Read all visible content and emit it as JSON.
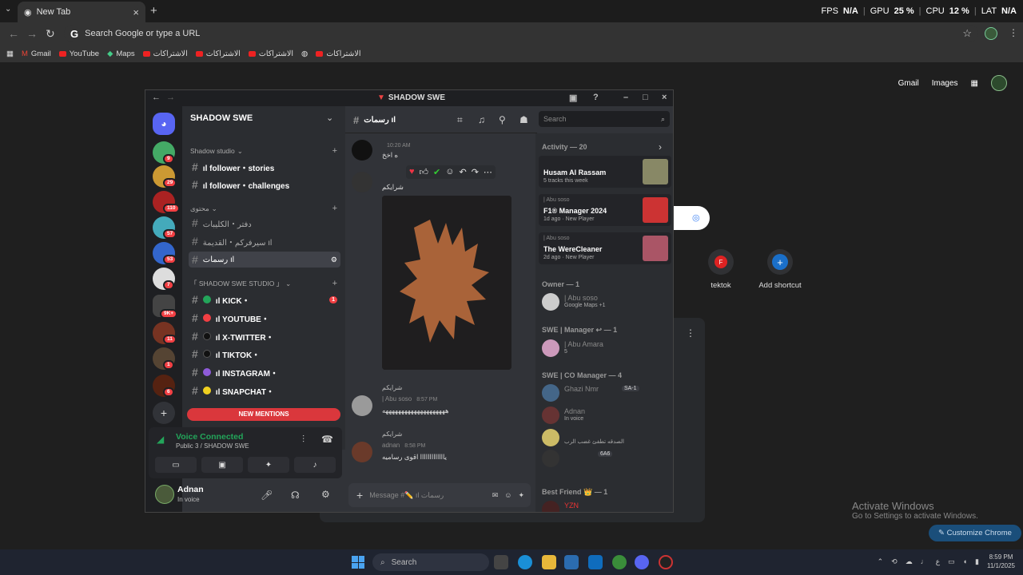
{
  "browser": {
    "tab_title": "New Tab",
    "stats": [
      {
        "label": "FPS",
        "value": "N/A"
      },
      {
        "label": "GPU",
        "value": "25 %"
      },
      {
        "label": "CPU",
        "value": "12 %"
      },
      {
        "label": "LAT",
        "value": "N/A"
      }
    ],
    "omnibox_placeholder": "Search Google or type a URL",
    "bookmarks": [
      "Gmail",
      "YouTube",
      "Maps",
      "الاشتراكات",
      "الاشتراكات",
      "الاشتراكات",
      "الاشتراكات"
    ]
  },
  "newtab": {
    "gmail": "Gmail",
    "images": "Images",
    "shortcuts": [
      {
        "label": "tektok",
        "letter": "F"
      },
      {
        "label": "Add shortcut",
        "letter": "+"
      }
    ],
    "activate_title": "Activate Windows",
    "activate_sub": "Go to Settings to activate Windows.",
    "customize": "Customize Chrome"
  },
  "discord": {
    "window_title": "SHADOW SWE",
    "server_name": "SHADOW SWE",
    "guild_badges": [
      "9",
      "29",
      "110",
      "57",
      "53",
      "7",
      "9K+",
      "11",
      "1",
      "6"
    ],
    "categories": {
      "shadow_studio": "Shadow studio",
      "content": "محتوى",
      "studio": "「 SHADOW SWE STUDIO 」"
    },
    "channels": [
      {
        "name": "ıl follower・stories"
      },
      {
        "name": "ıl follower・challenges"
      },
      {
        "name": "دفتر・الكليبات"
      },
      {
        "name": "سيرفركم・القديمة ıl"
      },
      {
        "name": "رسمات ıl"
      },
      {
        "name": "ıl KICK・",
        "badge": "1",
        "color": "#23a55a"
      },
      {
        "name": "ıl YOUTUBE・",
        "color": "#f23f43"
      },
      {
        "name": "ıl X-TWITTER・",
        "color": "#111111"
      },
      {
        "name": "ıl TIKTOK・",
        "color": "#111111"
      },
      {
        "name": "ıl INSTAGRAM・",
        "color": "#8e5bd9"
      },
      {
        "name": "ıl SNAPCHAT・",
        "color": "#f0d020"
      }
    ],
    "new_mentions": "NEW MENTIONS",
    "voice": {
      "title": "Voice Connected",
      "sub": "Public 3 / SHADOW SWE"
    },
    "user": {
      "name": "Adnan",
      "status": "In voice"
    },
    "chat": {
      "channel": "رسمات ıl",
      "msg1_time": "10:20 AM",
      "msg1_text": "ه اخخ",
      "msg2_text": "شرايكم",
      "msg3_reply": "شرايكم",
      "msg3_name": "| Abu soso",
      "msg3_time": "8:57 PM",
      "msg4_reply": "شرايكم",
      "msg4_name": "adnan",
      "msg4_time": "8:58 PM",
      "msg4_text": "يااااااااااااا اقوى رساميه",
      "input_placeholder": "Message #✏️ ıl رسمات"
    },
    "search_placeholder": "Search",
    "members": {
      "activity_header": "Activity — 20",
      "activities": [
        {
          "user": "",
          "title": "Husam Al Rassam",
          "sub": "5 tracks this week"
        },
        {
          "user": "| Abu soso",
          "title": "F1® Manager 2024",
          "sub": "1d ago · New Player"
        },
        {
          "user": "| Abu soso",
          "title": "The WereCleaner",
          "sub": "2d ago · New Player"
        }
      ],
      "owner_header": "Owner — 1",
      "owner": {
        "name": "| Abu soso",
        "status": "Google Maps +1"
      },
      "manager_header": "SWE | Manager ↩ — 1",
      "manager": {
        "name": "| Abu Amara",
        "status": "5"
      },
      "co_header": "SWE | CO Manager — 4",
      "co": [
        {
          "name": "Ghazi Nmr",
          "status": "SA-1"
        },
        {
          "name": "Adnan",
          "status": "In voice"
        },
        {
          "name": "",
          "status": "الصدقه تطفئ غضب الرب"
        },
        {
          "name": "",
          "status": "6A6"
        }
      ],
      "best_header": "Best Friend 👑 — 1",
      "best": {
        "name": "YZN"
      }
    }
  },
  "taskbar": {
    "search": "Search",
    "time": "8:59 PM",
    "date": "11/1/2025"
  }
}
